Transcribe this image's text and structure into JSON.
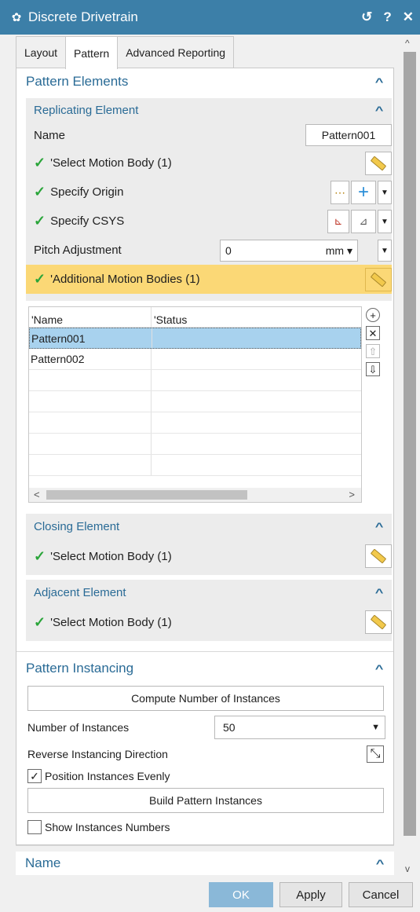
{
  "window": {
    "title": "Discrete Drivetrain",
    "reset_icon": "reset-icon",
    "help_label": "?",
    "close_label": "✕"
  },
  "tabs": [
    {
      "label": "Layout"
    },
    {
      "label": "Pattern"
    },
    {
      "label": "Advanced Reporting"
    }
  ],
  "pattern_elements": {
    "title": "Pattern Elements",
    "replicating": {
      "title": "Replicating Element",
      "name_label": "Name",
      "name_value": "Pattern001",
      "select_motion_body": "'Select Motion Body (1)",
      "specify_origin": "Specify Origin",
      "specify_csys": "Specify CSYS",
      "pitch_label": "Pitch Adjustment",
      "pitch_value": "0",
      "pitch_unit": "mm",
      "additional_bodies": "'Additional Motion Bodies (1)"
    },
    "table": {
      "columns": [
        "'Name",
        "'Status"
      ],
      "rows": [
        {
          "name": "Pattern001",
          "status": ""
        },
        {
          "name": "Pattern002",
          "status": ""
        }
      ]
    },
    "closing": {
      "title": "Closing Element",
      "select_motion_body": "'Select Motion Body (1)"
    },
    "adjacent": {
      "title": "Adjacent Element",
      "select_motion_body": "'Select Motion Body (1)"
    }
  },
  "pattern_instancing": {
    "title": "Pattern Instancing",
    "compute_button": "Compute Number of Instances",
    "num_instances_label": "Number of Instances",
    "num_instances_value": "50",
    "reverse_label": "Reverse Instancing Direction",
    "position_evenly_label": "Position Instances Evenly",
    "position_evenly_checked": true,
    "build_button": "Build Pattern Instances",
    "show_numbers_label": "Show Instances Numbers",
    "show_numbers_checked": false
  },
  "name_group": {
    "title": "Name"
  },
  "footer": {
    "ok_label": "OK",
    "apply_label": "Apply",
    "cancel_label": "Cancel"
  },
  "colors": {
    "titlebar": "#3c7fa8",
    "accent_text": "#2a6b96",
    "highlight": "#fbd876",
    "selection": "#a8d2ee",
    "check": "#2aa53a",
    "ok_button": "#8ab8d8"
  }
}
